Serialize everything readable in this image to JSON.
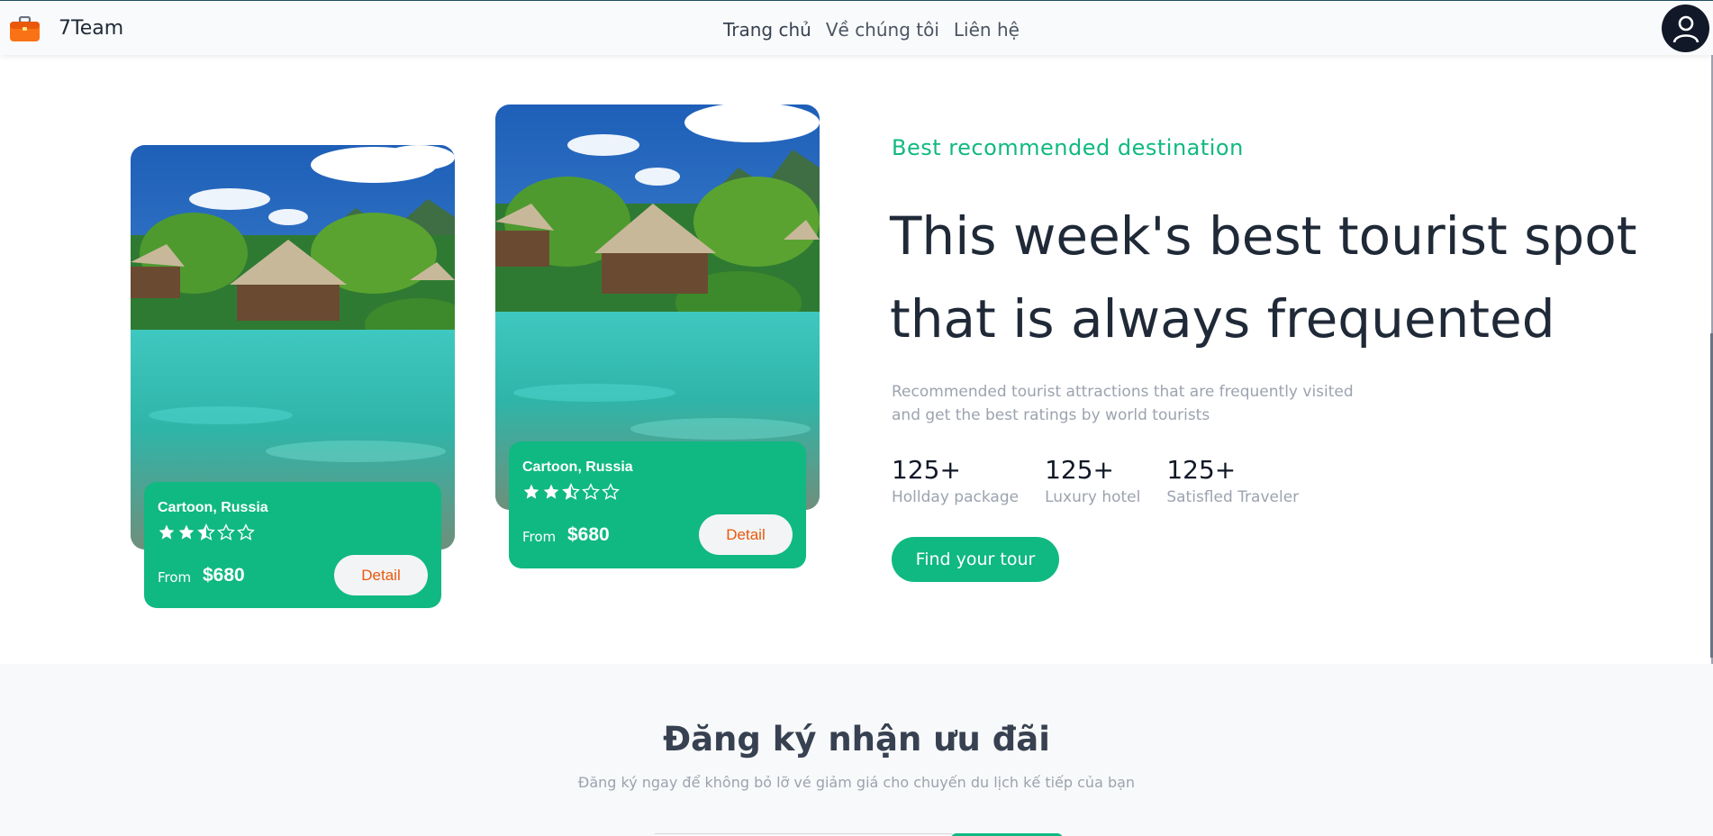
{
  "navbar": {
    "brand": "7Team",
    "links": [
      "Trang chủ",
      "Về chúng tôi",
      "Liên hệ"
    ],
    "avatar_icon": "user-avatar-icon",
    "brand_icon": "briefcase-icon",
    "accent": "#10b981"
  },
  "cards": [
    {
      "title": "Cartoon, Russia",
      "rating": 2.5,
      "max_rating": 5,
      "from_label": "From",
      "price": "$680",
      "button": "Detail"
    },
    {
      "title": "Cartoon, Russia",
      "rating": 2.5,
      "max_rating": 5,
      "from_label": "From",
      "price": "$680",
      "button": "Detail"
    }
  ],
  "hero": {
    "eyebrow": "Best recommended destination",
    "headline": "This week's best tourist spot that is always frequented",
    "description": "Recommended tourist attractions that are frequently visited and get the best ratings by world tourists",
    "stats": [
      {
        "value": "125+",
        "label": "Hollday package"
      },
      {
        "value": "125+",
        "label": "Luxury hotel"
      },
      {
        "value": "125+",
        "label": "Satisfled Traveler"
      }
    ],
    "cta": "Find your tour"
  },
  "newsletter": {
    "title": "Đăng ký nhận ưu đãi",
    "subtitle": "Đăng ký ngay để không bỏ lỡ vé giảm giá cho chuyến du lịch kế tiếp của bạn"
  }
}
